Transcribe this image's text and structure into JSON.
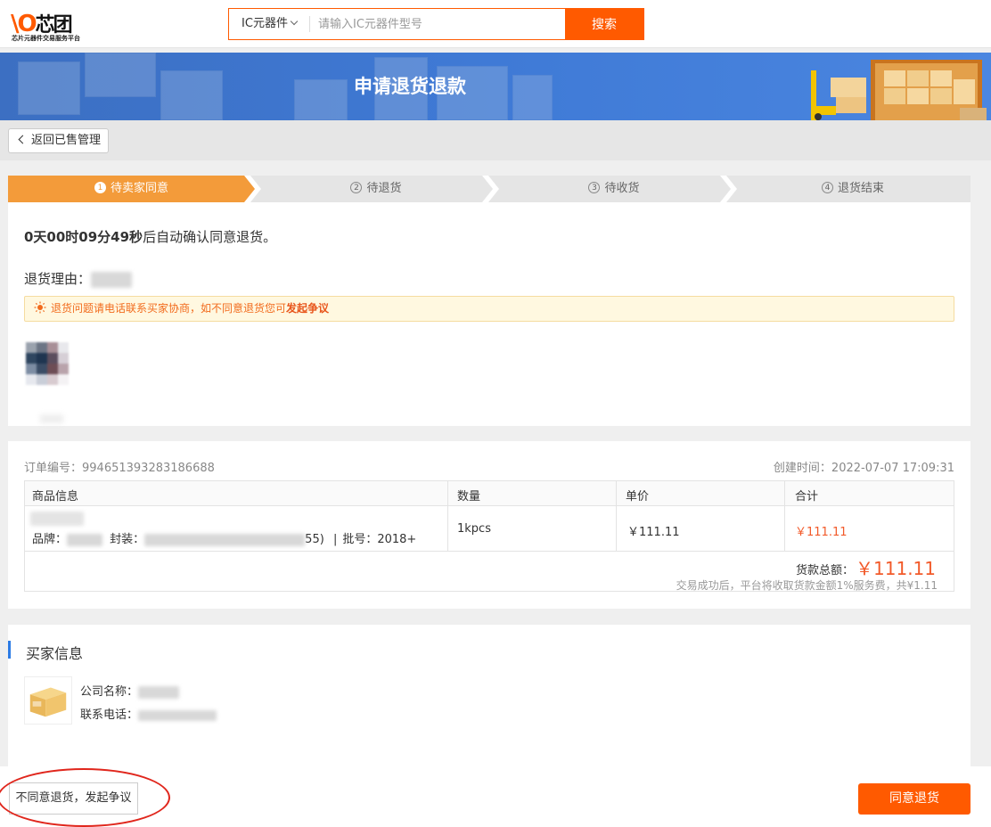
{
  "header": {
    "logo_name": "芯团",
    "logo_tagline": "芯片元器件交易服务平台",
    "search_category": "IC元器件",
    "search_placeholder": "请输入IC元器件型号",
    "search_button": "搜索"
  },
  "banner": {
    "title": "申请退货退款"
  },
  "back_button": "返回已售管理",
  "steps": [
    {
      "num": "1",
      "label": "待卖家同意",
      "active": true
    },
    {
      "num": "2",
      "label": "待退货",
      "active": false
    },
    {
      "num": "3",
      "label": "待收货",
      "active": false
    },
    {
      "num": "4",
      "label": "退货结束",
      "active": false
    }
  ],
  "status": {
    "countdown_bold": "0天00时09分49秒",
    "countdown_rest": "后自动确认同意退货。",
    "reason_label": "退货理由："
  },
  "notice": {
    "text": "退货问题请电话联系买家协商，如不同意退货您可",
    "link": "发起争议"
  },
  "order": {
    "number_label": "订单编号：",
    "number": "994651393283186688",
    "created_label": "创建时间：",
    "created": "2022-07-07 17:09:31",
    "columns": [
      "商品信息",
      "数量",
      "单价",
      "合计"
    ],
    "brand_label": "品牌：",
    "package_label": "封装：",
    "package_tail": "55)",
    "sep": "|",
    "batch_label": "批号：",
    "batch": "2018+",
    "quantity": "1kpcs",
    "unit_price": "￥111.11",
    "subtotal": "￥111.11",
    "total_label": "货款总额：",
    "total": "￥111.11",
    "fee_note": "交易成功后，平台将收取货款金额1%服务费，共¥1.11"
  },
  "buyer": {
    "heading": "买家信息",
    "company_label": "公司名称：",
    "phone_label": "联系电话："
  },
  "footer": {
    "dispute_button": "不同意退货，发起争议",
    "agree_button": "同意退货"
  },
  "colors": {
    "accent": "#ff5a00",
    "step_active": "#f39b3a",
    "price_red": "#f25a2a",
    "annotation_red": "#e0261c"
  }
}
